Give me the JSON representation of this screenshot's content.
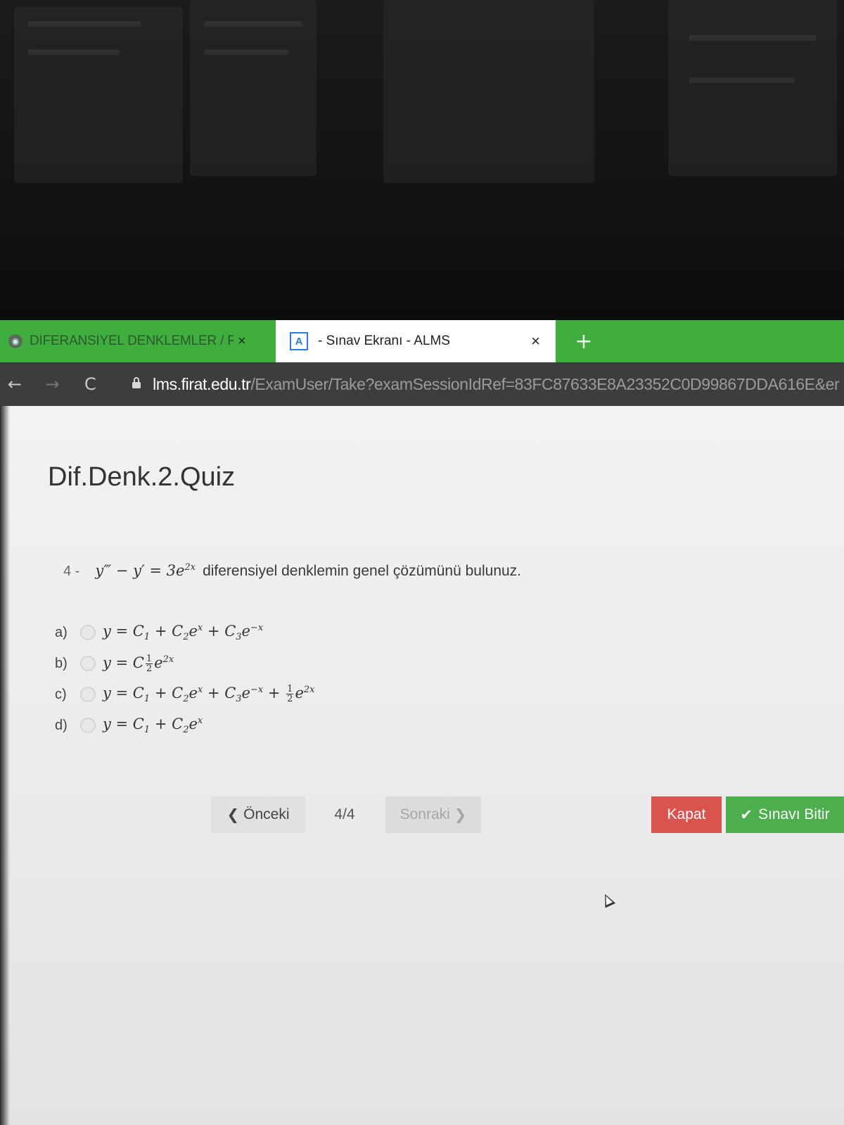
{
  "browser": {
    "tabs": [
      {
        "label": "DİFERANSİYEL DENKLEMLER / Re",
        "close": "×"
      },
      {
        "label": "- Sınav Ekranı - ALMS",
        "favicon": "A",
        "close": "×"
      }
    ],
    "new_tab": "+",
    "nav": {
      "back": "←",
      "forward": "→",
      "reload": "C"
    },
    "url": {
      "host": "lms.firat.edu.tr",
      "path": "/ExamUser/Take?examSessionIdRef=83FC87633E8A23352C0D99867DDA616E&er"
    }
  },
  "exam": {
    "title": "Dif.Denk.2.Quiz",
    "question": {
      "number": "4 -",
      "text": "diferensiyel denklemin genel çözümünü bulunuz."
    },
    "options": [
      {
        "label": "a)"
      },
      {
        "label": "b)"
      },
      {
        "label": "c)"
      },
      {
        "label": "d)"
      }
    ],
    "pager": {
      "prev": "Önceki",
      "count": "4/4",
      "next": "Sonraki"
    },
    "actions": {
      "close": "Kapat",
      "finish": "Sınavı Bitir"
    }
  },
  "icons": [
    "browser-favicon",
    "alms-favicon",
    "close-icon",
    "plus-icon",
    "back-arrow-icon",
    "forward-arrow-icon",
    "reload-icon",
    "lock-icon",
    "chevron-left-icon",
    "chevron-right-icon",
    "check-icon",
    "mouse-cursor-icon"
  ]
}
